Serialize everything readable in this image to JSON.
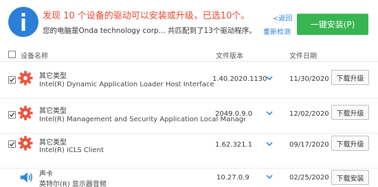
{
  "header": {
    "headline": "发现 10 个设备的驱动可以安装或升级，已选10个。",
    "subline": "您的电脑是Onda technology corp...  共匹配到了13个驱动程序。",
    "back_label": "<返回",
    "rescan_label": "重新检测",
    "install_all_label": "一键安装(P)"
  },
  "columns": {
    "device_name": "设备名称",
    "file_version": "文件版本",
    "file_date": "文件日期"
  },
  "rows": [
    {
      "category": "其它类型",
      "name": "Intel(R) Dynamic Application Loader Host Interface",
      "version": "1.40.2020.1130",
      "date": "11/30/2020",
      "action": "下载升级",
      "checked": true,
      "icon": "gear-icon"
    },
    {
      "category": "其它类型",
      "name": "Intel(R) Management and Security Application Local Managemen…",
      "version": "2049.0.9.0",
      "date": "12/02/2020",
      "action": "下载升级",
      "checked": true,
      "icon": "gear-icon"
    },
    {
      "category": "其它类型",
      "name": "Intel(R) iCLS Client",
      "version": "1.62.321.1",
      "date": "09/17/2020",
      "action": "下载升级",
      "checked": true,
      "icon": "gear-icon"
    },
    {
      "category": "声卡",
      "name": "英特尔(R) 显示器音频",
      "version": "10.27.0.9",
      "date": "02/25/2020",
      "action": "下载安装",
      "checked": false,
      "icon": "speaker-icon"
    }
  ],
  "colors": {
    "accent_blue": "#2b7fd6",
    "headline_red": "#e8452c",
    "install_green": "#36b552",
    "gear_red": "#e8563f"
  }
}
